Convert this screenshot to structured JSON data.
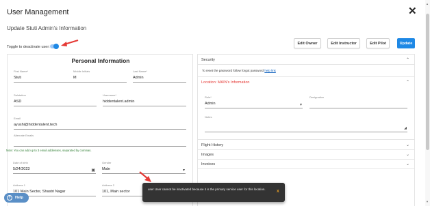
{
  "header": {
    "title": "User Management",
    "close_icon": "close-icon",
    "subtitle": "Update Stuti Admin's Information"
  },
  "toggle": {
    "label": "Toggle to deactivate user:",
    "on": true
  },
  "buttons": {
    "edit_owner": "Edit Owner",
    "edit_instructor": "Edit Instructor",
    "edit_pilot": "Edit Pilot",
    "update": "Update"
  },
  "personal": {
    "title": "Personal Information",
    "first_name": {
      "label": "First Name*",
      "value": "Stuti"
    },
    "middle_initials": {
      "label": "Middle Initials",
      "value": "M"
    },
    "last_name": {
      "label": "Last Name*",
      "value": "Admin"
    },
    "salutation": {
      "label": "Salutation",
      "value": "ASD"
    },
    "username": {
      "label": "Username*",
      "value": "hiddentalent.admin"
    },
    "email": {
      "label": "Email",
      "value": "ayushi@hiddentalent.tech"
    },
    "alternate_emails": {
      "label": "Alternate Emails",
      "value": ""
    },
    "note": "Note: You can add up to 3 email addresses, separated by commas.",
    "dob": {
      "label": "Date of birth",
      "value": "5/24/2023"
    },
    "gender": {
      "label": "Gender",
      "value": "Male"
    },
    "address1": {
      "label": "Address 1",
      "value": "101 Main Sector, Shastri Nagar"
    },
    "address2": {
      "label": "Address 2",
      "value": "101, Main sector"
    }
  },
  "right": {
    "security": {
      "label": "Security",
      "text": "To reset the password follow forgot password",
      "link": "help link"
    },
    "location": {
      "label": "Location: MAIN's Information"
    },
    "role": {
      "label": "Role*",
      "value": "Admin"
    },
    "designation": {
      "label": "Designation",
      "value": ""
    },
    "notes": {
      "label": "Notes",
      "value": ""
    },
    "sections": {
      "flight_history": "Flight History",
      "images": "Images",
      "invoices": "Invoices"
    }
  },
  "toast": {
    "message": "user User cannot be inactivated because it is the primary service user for this location.",
    "close": "X"
  },
  "help": {
    "label": "Help"
  },
  "colors": {
    "primary": "#1e88e5",
    "danger": "#e53935",
    "note": "#2e7d32",
    "toast_bg": "#333333",
    "help_bg": "#5a8fc6"
  }
}
